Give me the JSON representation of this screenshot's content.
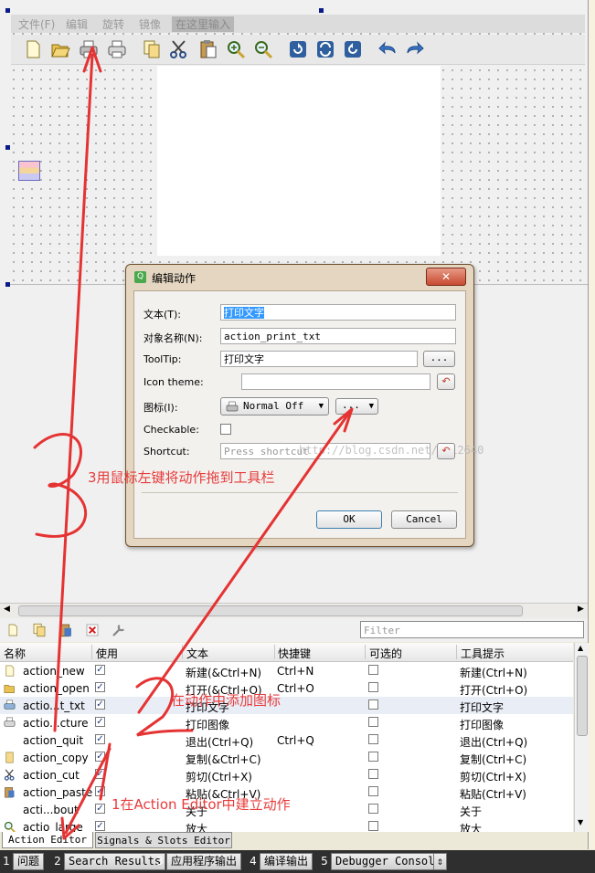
{
  "menubar": {
    "items": [
      "文件(F)",
      "编辑",
      "旋转",
      "镜像",
      "在这里输入"
    ]
  },
  "toolbar": {
    "icons": [
      "new-file-icon",
      "open-folder-icon",
      "print-text-icon",
      "print-image-icon",
      "copy-icon",
      "cut-icon",
      "paste-icon",
      "zoom-in-icon",
      "zoom-out-icon",
      "rotate-90-icon",
      "rotate-180-icon",
      "rotate-270-icon",
      "undo-icon",
      "redo-icon"
    ]
  },
  "dialog": {
    "title": "编辑动作",
    "close": "✕",
    "text_label": "文本(T):",
    "text_value": "打印文字",
    "object_label": "对象名称(N):",
    "object_value": "action_print_txt",
    "tooltip_label": "ToolTip:",
    "tooltip_value": "打印文字",
    "tooltip_btn": "...",
    "icon_theme_label": "Icon theme:",
    "icon_label": "图标(I):",
    "icon_mode": "Normal Off",
    "icon_more": "...",
    "checkable_label": "Checkable:",
    "shortcut_label": "Shortcut:",
    "shortcut_placeholder": "Press shortcut",
    "watermark": "http://blog.csdn.net/u012640",
    "ok": "OK",
    "cancel": "Cancel"
  },
  "filter_placeholder": "Filter",
  "table": {
    "headers": [
      "名称",
      "使用",
      "文本",
      "快捷键",
      "可选的",
      "工具提示"
    ],
    "rows": [
      {
        "name": "action_new",
        "used": true,
        "text": "新建(&Ctrl+N)",
        "shortcut": "Ctrl+N",
        "tip": "新建(Ctrl+N)",
        "icon": "new-file-icon"
      },
      {
        "name": "action_open",
        "used": true,
        "text": "打开(&Ctrl+O)",
        "shortcut": "Ctrl+O",
        "tip": "打开(Ctrl+O)",
        "icon": "open-folder-icon"
      },
      {
        "name": "actio...t_txt",
        "used": true,
        "text": "打印文字",
        "shortcut": "",
        "tip": "打印文字",
        "icon": "print-text-icon"
      },
      {
        "name": "actio...cture",
        "used": true,
        "text": "打印图像",
        "shortcut": "",
        "tip": "打印图像",
        "icon": "print-image-icon"
      },
      {
        "name": "action_quit",
        "used": true,
        "text": "退出(Ctrl+Q)",
        "shortcut": "Ctrl+Q",
        "tip": "退出(Ctrl+Q)",
        "icon": ""
      },
      {
        "name": "action_copy",
        "used": true,
        "text": "复制(&Ctrl+C)",
        "shortcut": "",
        "tip": "复制(Ctrl+C)",
        "icon": "copy-icon"
      },
      {
        "name": "action_cut",
        "used": true,
        "text": "剪切(Ctrl+X)",
        "shortcut": "",
        "tip": "剪切(Ctrl+X)",
        "icon": "cut-icon"
      },
      {
        "name": "action_paste",
        "used": true,
        "text": "粘贴(&Ctrl+V)",
        "shortcut": "",
        "tip": "粘贴(Ctrl+V)",
        "icon": "paste-icon"
      },
      {
        "name": "acti...bout",
        "used": true,
        "text": "关于",
        "shortcut": "",
        "tip": "关于",
        "icon": ""
      },
      {
        "name": "actio_large",
        "used": true,
        "text": "放大",
        "shortcut": "",
        "tip": "放大",
        "icon": "zoom-in-icon"
      }
    ]
  },
  "tabs": {
    "action_editor": "Action Editor",
    "signals_slots": "Signals & Slots Editor"
  },
  "statusbar": [
    {
      "num": "1",
      "label": "问题"
    },
    {
      "num": "2",
      "label": "Search Results"
    },
    {
      "num": "3",
      "label": "应用程序输出"
    },
    {
      "num": "4",
      "label": "编译输出"
    },
    {
      "num": "5",
      "label": "Debugger Console"
    }
  ],
  "annotations": {
    "step3": "3用鼠标左键将动作拖到工具栏",
    "step2": "在动作中添加图标",
    "step1": "1在Action Editor中建立动作",
    "big3": "3",
    "big2": "2",
    "big1": "1"
  },
  "colors": {
    "annotation": "#e73b3b",
    "selection": "#3399ff"
  }
}
